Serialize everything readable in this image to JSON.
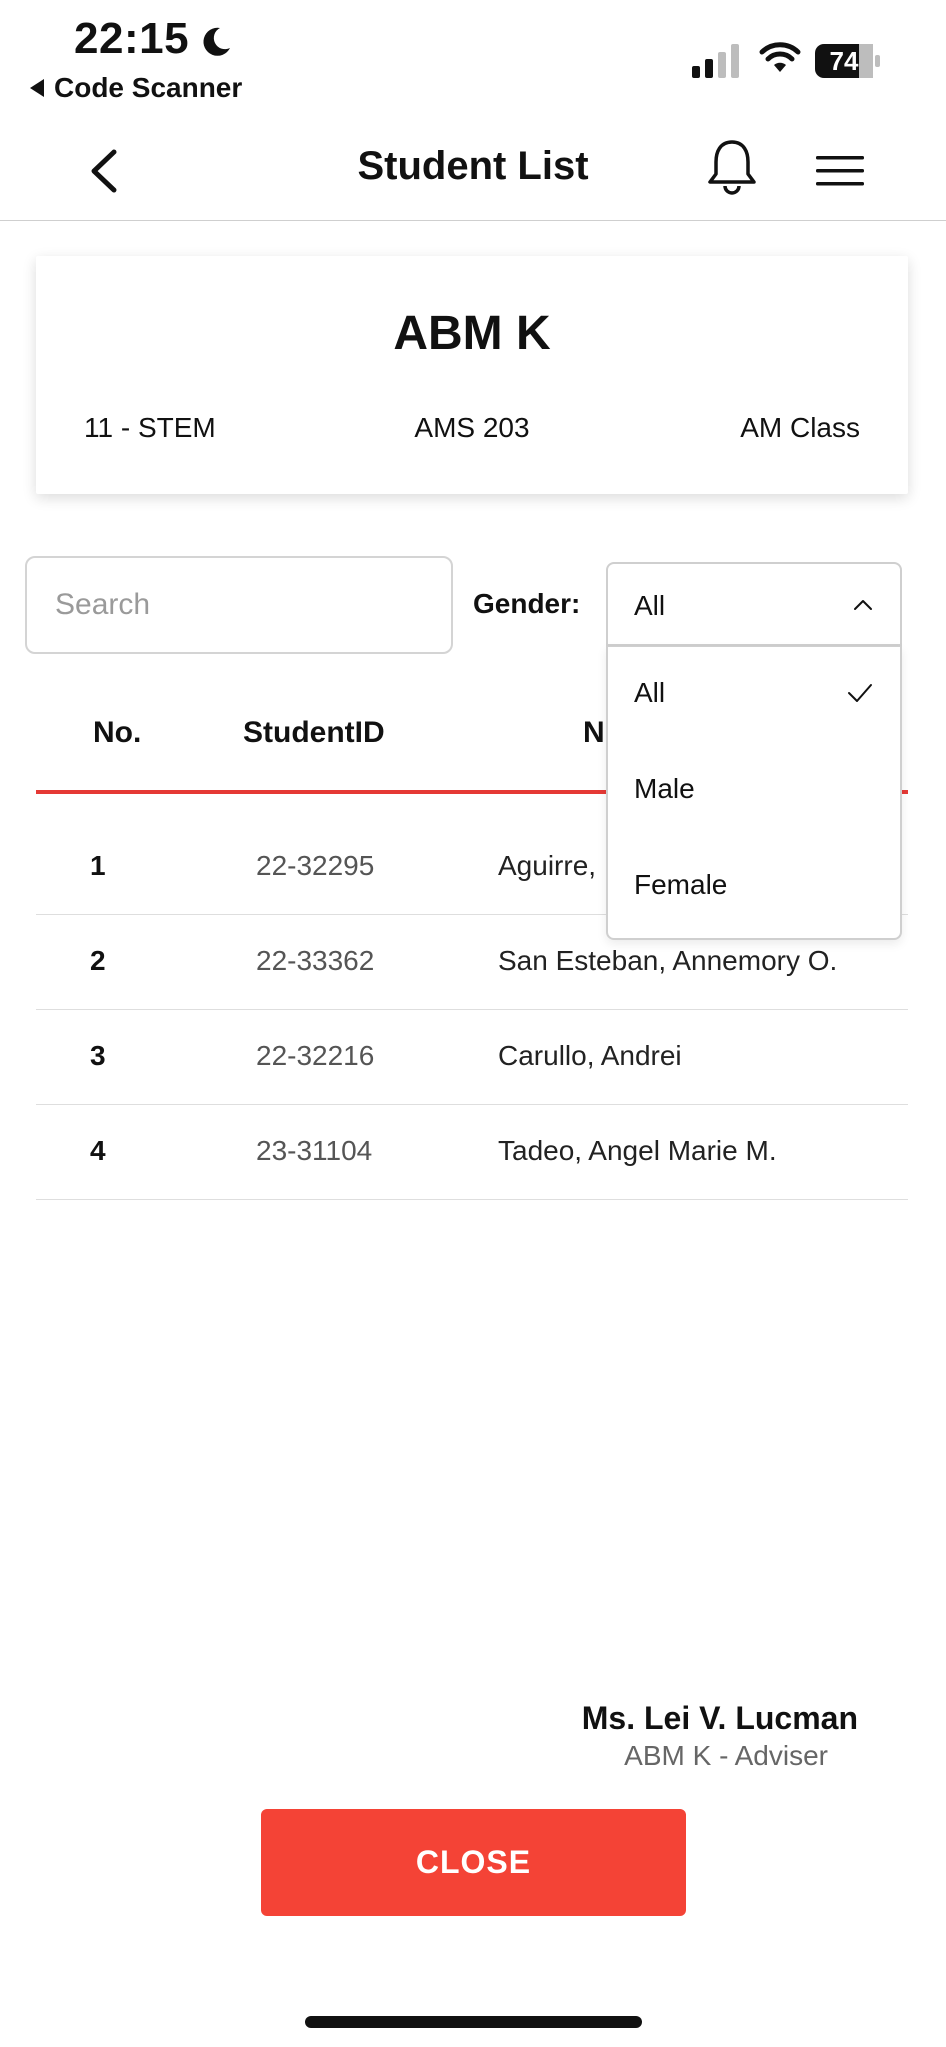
{
  "status_bar": {
    "time": "22:15",
    "back_app": "Code Scanner",
    "battery": "74"
  },
  "nav": {
    "title": "Student List"
  },
  "class_card": {
    "name": "ABM K",
    "grade_strand": "11 - STEM",
    "room": "AMS 203",
    "session": "AM Class"
  },
  "filters": {
    "search_placeholder": "Search",
    "search_value": "",
    "gender_label": "Gender:",
    "gender_selected": "All",
    "gender_options": [
      "All",
      "Male",
      "Female"
    ]
  },
  "table": {
    "headers": [
      "No.",
      "StudentID",
      "N"
    ],
    "rows": [
      {
        "no": "1",
        "id": "22-32295",
        "name": "Aguirre,"
      },
      {
        "no": "2",
        "id": "22-33362",
        "name": "San Esteban, Annemory O."
      },
      {
        "no": "3",
        "id": "22-32216",
        "name": "Carullo, Andrei"
      },
      {
        "no": "4",
        "id": "23-31104",
        "name": "Tadeo, Angel Marie M."
      }
    ]
  },
  "adviser": {
    "name": "Ms. Lei V. Lucman",
    "role": "ABM K - Adviser"
  },
  "close_label": "CLOSE",
  "colors": {
    "accent": "#f44336",
    "header_underline": "#e53935"
  }
}
